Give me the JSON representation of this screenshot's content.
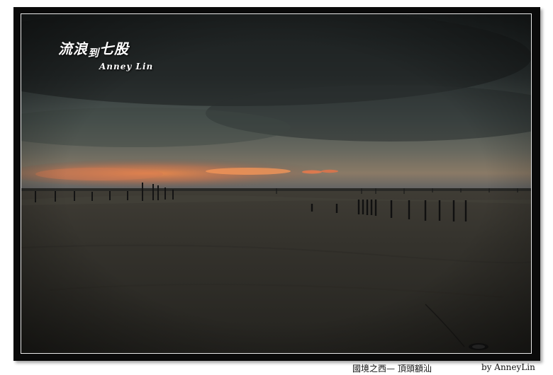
{
  "photo": {
    "title_part1": "流浪",
    "title_part2": "到",
    "title_part3": "七股",
    "signature": "Anney Lin"
  },
  "caption": "國境之西— 頂頭額汕",
  "byline": "by AnneyLin"
}
